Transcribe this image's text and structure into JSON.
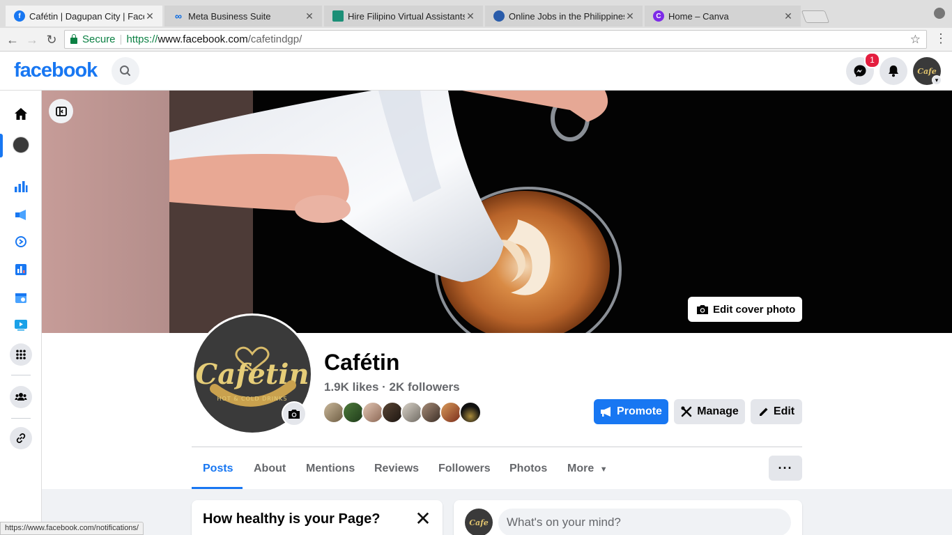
{
  "browser": {
    "tabs": [
      {
        "title": "Cafétin | Dagupan City | Facebook",
        "favicon": "facebook-icon",
        "color": "#1877f2",
        "active": true
      },
      {
        "title": "Meta Business Suite",
        "favicon": "meta-icon",
        "color": "#0668e1",
        "active": false
      },
      {
        "title": "Hire Filipino Virtual Assistants",
        "favicon": "virtual-assistants-icon",
        "color": "#1c8f77",
        "active": false
      },
      {
        "title": "Online Jobs in the Philippines",
        "favicon": "onlinejobs-icon",
        "color": "#2a5caa",
        "active": false
      },
      {
        "title": "Home – Canva",
        "favicon": "canva-icon",
        "color": "#7d2ae8",
        "active": false
      }
    ],
    "secure_label": "Secure",
    "url_scheme": "https://",
    "url_host": "www.facebook.com",
    "url_path": "/cafetindgp/",
    "status_url": "https://www.facebook.com/notifications/"
  },
  "header": {
    "logo": "facebook",
    "messenger_badge": "1"
  },
  "cover": {
    "edit_cover_label": "Edit cover photo"
  },
  "page": {
    "name": "Cafétin",
    "stats": "1.9K likes · 2K followers",
    "logo_text": "Cafetin",
    "logo_subtext": "HOT & COLD DRINKS",
    "buttons": {
      "promote": "Promote",
      "manage": "Manage",
      "edit": "Edit"
    },
    "tabs": [
      "Posts",
      "About",
      "Mentions",
      "Reviews",
      "Followers",
      "Photos",
      "More"
    ],
    "more_menu": "···"
  },
  "cards": {
    "health_title": "How healthy is your Page?",
    "composer_placeholder": "What's on your mind?"
  },
  "colors": {
    "brand": "#1877f2",
    "badge": "#e41e3f"
  }
}
